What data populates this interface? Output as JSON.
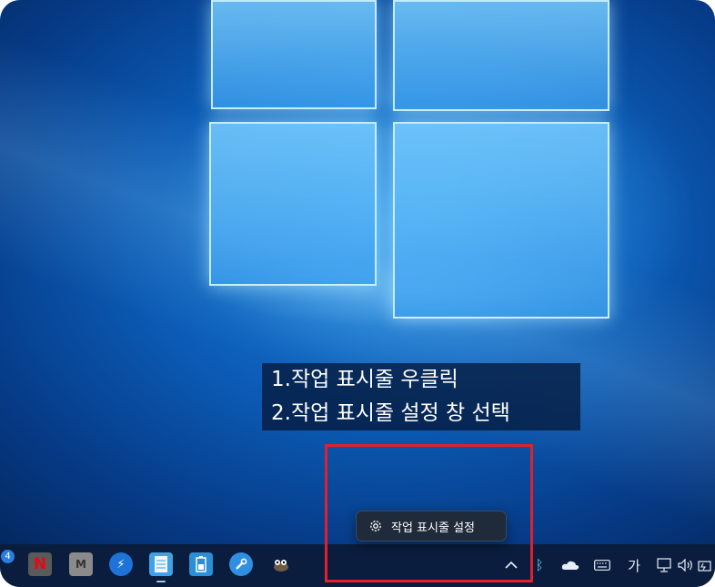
{
  "instructions": {
    "line1": "1.작업 표시줄 우클릭",
    "line2": "2.작업 표시줄 설정 창 선택"
  },
  "context_menu": {
    "item_label": "작업 표시줄 설정",
    "icon": "gear-icon"
  },
  "taskbar": {
    "badge_count": "4",
    "apps": [
      {
        "name": "netflix-icon",
        "glyph": "N",
        "color": "#e50914"
      },
      {
        "name": "m-app-icon",
        "glyph": "M",
        "color": "#9a9a9a"
      },
      {
        "name": "lightning-app-icon",
        "glyph": "⚡",
        "color": "#1d73d8"
      },
      {
        "name": "notepad-icon",
        "glyph": "",
        "color": "#3fa2e8"
      },
      {
        "name": "battery-app-icon",
        "glyph": "",
        "color": "#2a8fd6"
      },
      {
        "name": "wrench-app-icon",
        "glyph": "",
        "color": "#2f8fe0"
      },
      {
        "name": "gimp-icon",
        "glyph": "",
        "color": "#7a6a4a"
      }
    ],
    "tray": {
      "chevron": "^",
      "bluetooth": "ᛒ",
      "ime_label": "가"
    }
  },
  "highlight_color": "#e3202a"
}
